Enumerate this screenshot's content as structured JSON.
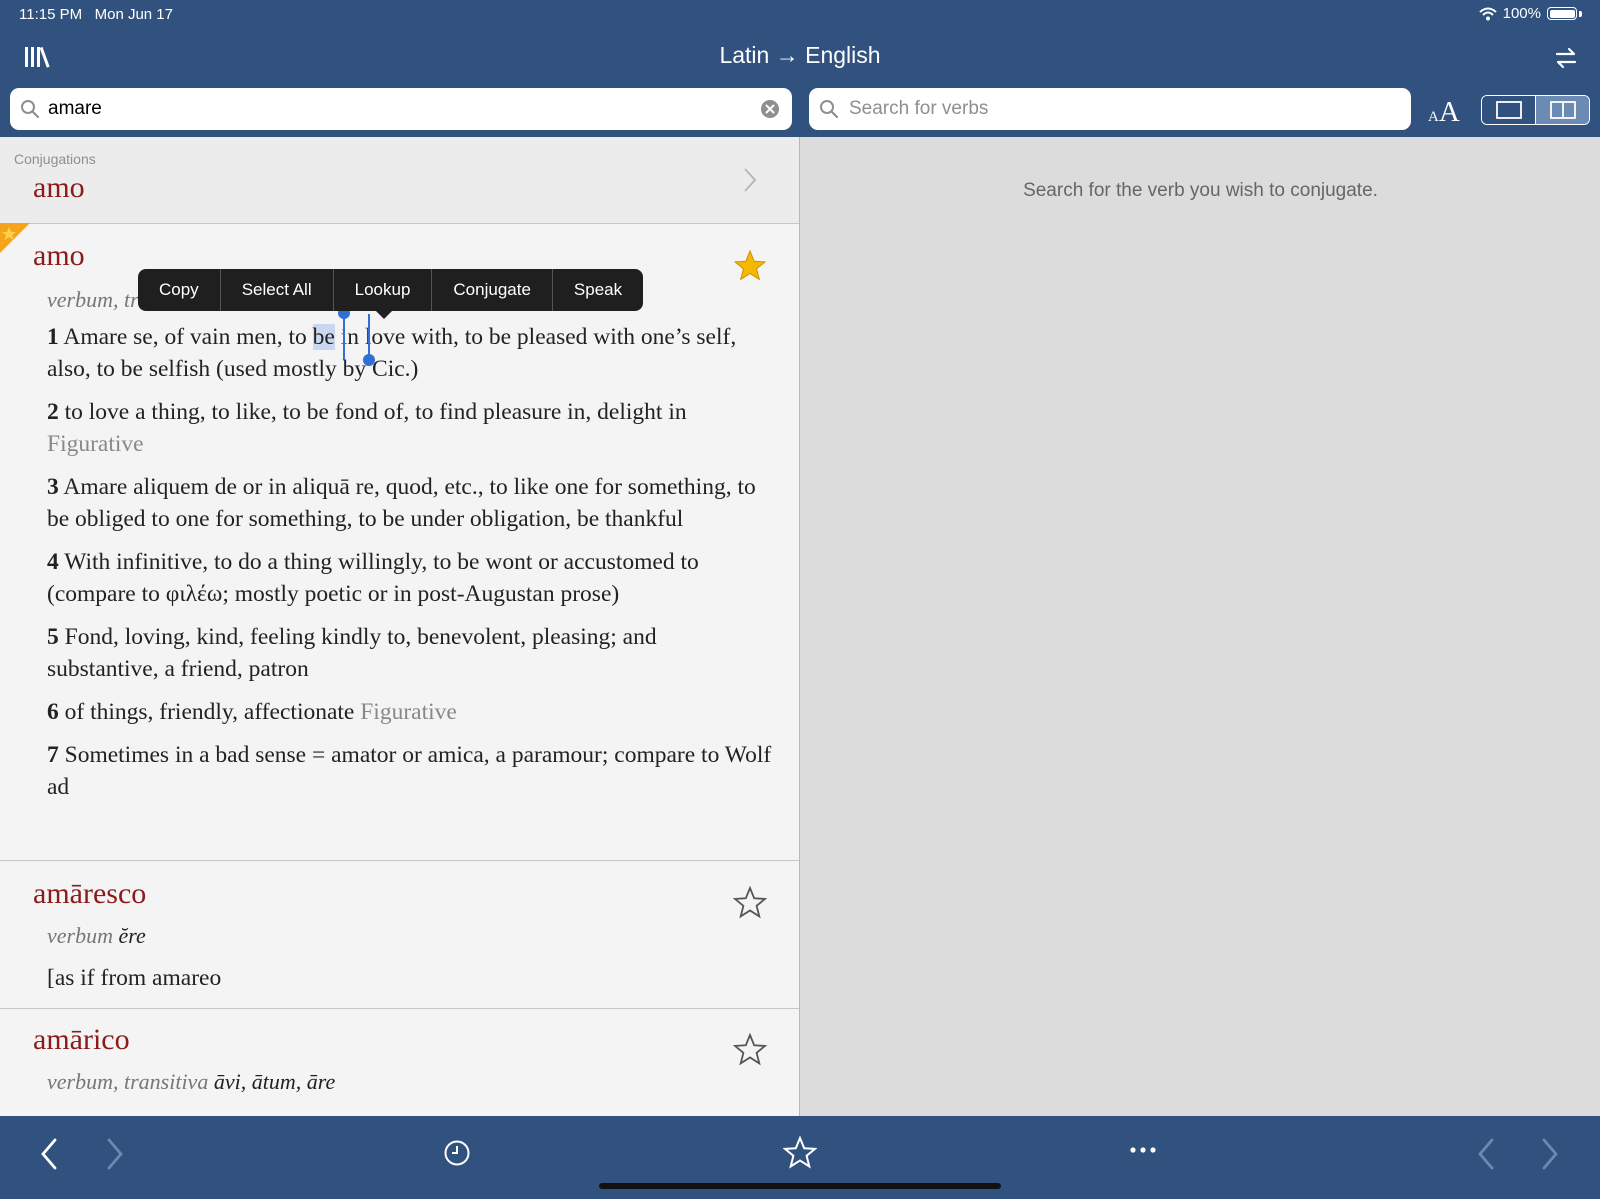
{
  "status_bar": {
    "time": "11:15 PM",
    "date": "Mon Jun 17",
    "battery": "100%"
  },
  "nav": {
    "title": "Latin → English"
  },
  "search_left": {
    "value": "amare"
  },
  "search_right": {
    "placeholder": "Search for verbs"
  },
  "font_size_button": {
    "small": "A",
    "big": "A"
  },
  "conjugations": {
    "label": "Conjugations",
    "word": "amo"
  },
  "context_menu": {
    "items": [
      "Copy",
      "Select All",
      "Lookup",
      "Conjugate",
      "Speak"
    ]
  },
  "entries": [
    {
      "headword": "amo",
      "grammar": "verbum, tr",
      "starred": true,
      "senses": [
        {
          "num": "1",
          "pre": "Amare se, of vain men, to ",
          "selected": "be",
          "post": " in love with, to be pleased with one’s self, also, to be selfish (used mostly by Cic.)"
        },
        {
          "num": "2",
          "text": "to love a thing, to like, to be fond of, to find pleasure in, delight in",
          "tag": "Figurative"
        },
        {
          "num": "3",
          "text": "Amare aliquem de or in aliquā re, quod, etc., to like one for something, to be obliged to one for something, to be under obligation, be thankful"
        },
        {
          "num": "4",
          "text": "With infinitive, to do a thing willingly, to be wont or accustomed to (compare to φιλέω; mostly poetic or in post-Augustan prose)"
        },
        {
          "num": "5",
          "text": "Fond, loving, kind, feeling kindly to, benevolent, pleasing; and substantive, a friend, patron"
        },
        {
          "num": "6",
          "text": "of things, friendly, affectionate",
          "tag": "Figurative"
        },
        {
          "num": "7",
          "text": "Sometimes in a bad sense = amator or amica, a paramour; compare to Wolf ad"
        }
      ]
    },
    {
      "headword": "amāresco",
      "grammar": "verbum",
      "forms": "ĕre",
      "starred": false,
      "body": "[as if from amareo"
    },
    {
      "headword": "amārico",
      "grammar": "verbum, transitiva",
      "forms": "āvi, ātum, āre",
      "starred": false
    }
  ],
  "right_pane": {
    "message": "Search for the verb you wish to conjugate."
  },
  "colors": {
    "bar": "#31527e",
    "headword": "#8c1a1a",
    "star_fill": "#f5b800",
    "selection": "#2f6fd6"
  },
  "icons": [
    "library-icon",
    "swap-languages-icon",
    "search-icon",
    "clear-icon",
    "chevron-right-icon",
    "star-icon",
    "back-icon",
    "forward-icon",
    "history-icon",
    "favorites-icon",
    "more-icon"
  ]
}
